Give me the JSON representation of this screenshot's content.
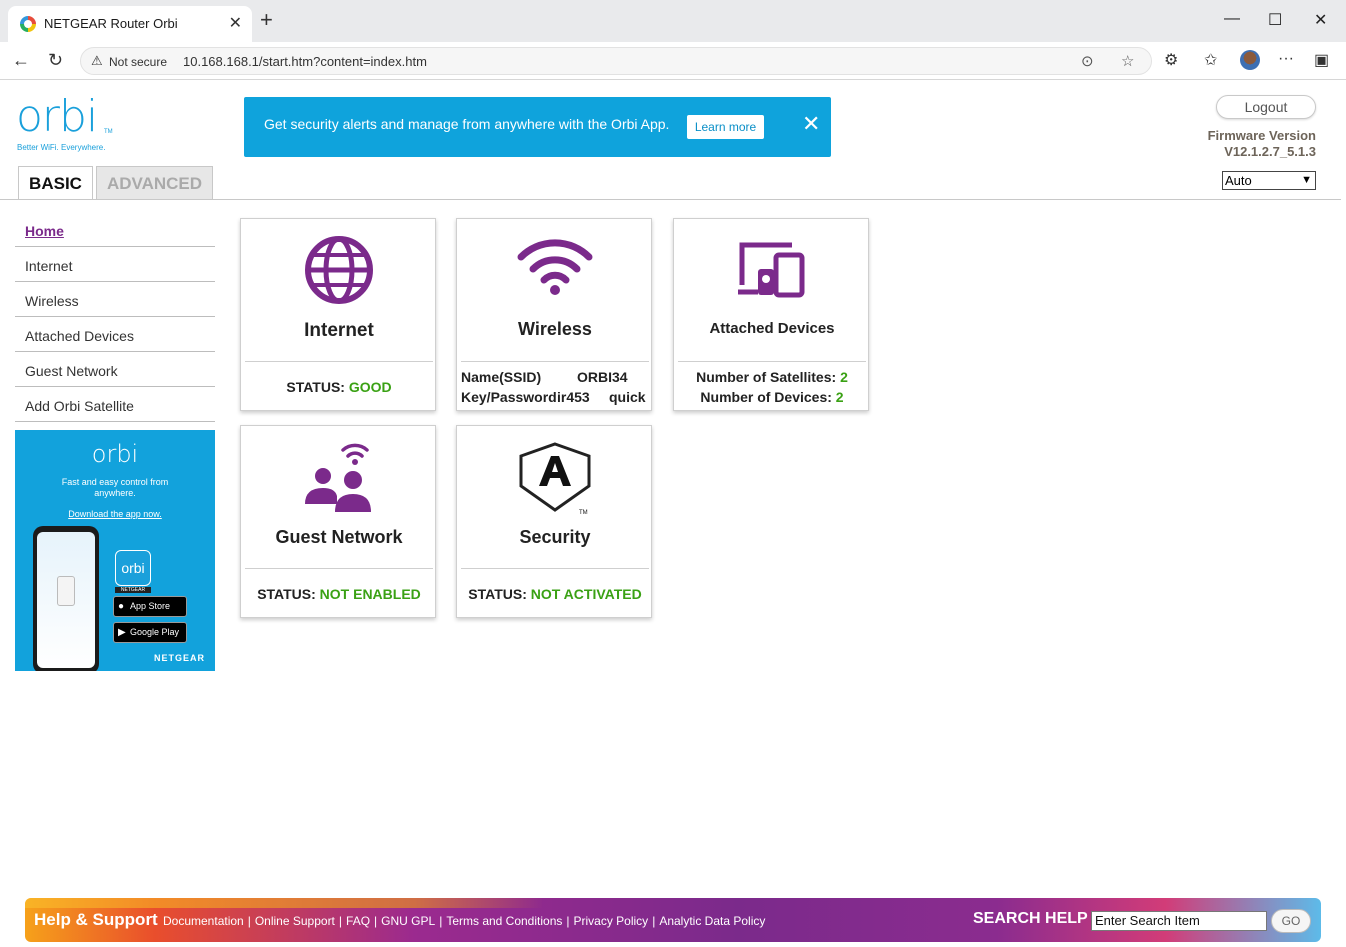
{
  "browser": {
    "tab_title": "NETGEAR Router Orbi",
    "security_label": "Not secure",
    "url": "10.168.168.1/start.htm?content=index.htm"
  },
  "header": {
    "logo": "orbi",
    "logo_tm": "TM",
    "tagline": "Better WiFi. Everywhere.",
    "banner_text": "Get security alerts and manage from anywhere with the Orbi App.",
    "banner_button": "Learn more",
    "logout": "Logout",
    "firmware_label": "Firmware Version",
    "firmware_version": "V12.1.2.7_5.1.3",
    "language": "Auto"
  },
  "tabs": {
    "basic": "BASIC",
    "advanced": "ADVANCED"
  },
  "sidebar": {
    "items": [
      {
        "label": "Home"
      },
      {
        "label": "Internet"
      },
      {
        "label": "Wireless"
      },
      {
        "label": "Attached Devices"
      },
      {
        "label": "Guest Network"
      },
      {
        "label": "Add Orbi Satellite"
      }
    ]
  },
  "promo": {
    "logo": "orbi",
    "text_line1": "Fast and easy control from",
    "text_line2": "anywhere.",
    "link": "Download the app now.",
    "app_icon": "orbi",
    "app_tag": "NETGEAR",
    "app_store": "App Store",
    "google_play": "Google Play",
    "brand": "NETGEAR"
  },
  "cards": {
    "internet": {
      "title": "Internet",
      "status_label": "STATUS:",
      "status_value": "GOOD"
    },
    "wireless": {
      "title": "Wireless",
      "ssid_label": "Name(SSID)",
      "ssid_value": "ORBI34",
      "key_label": "Key/Password",
      "key_value": "ir453",
      "key_value2": "quick"
    },
    "attached": {
      "title": "Attached Devices",
      "sat_label": "Number of Satellites:",
      "sat_value": "2",
      "dev_label": "Number of Devices:",
      "dev_value": "2"
    },
    "guest": {
      "title": "Guest Network",
      "status_label": "STATUS:",
      "status_value": "NOT ENABLED"
    },
    "security": {
      "title": "Security",
      "status_label": "STATUS:",
      "status_value": "NOT ACTIVATED"
    }
  },
  "footer": {
    "help": "Help & Support",
    "links": [
      "Documentation",
      "Online Support",
      "FAQ",
      "GNU GPL",
      "Terms and Conditions",
      "Privacy Policy",
      "Analytic Data Policy"
    ],
    "search_label": "SEARCH HELP",
    "search_value": "Enter Search Item",
    "go": "GO"
  },
  "colors": {
    "accent_purple": "#7b2a8b",
    "status_green": "#3aa114",
    "banner_blue": "#0fa3dc"
  }
}
